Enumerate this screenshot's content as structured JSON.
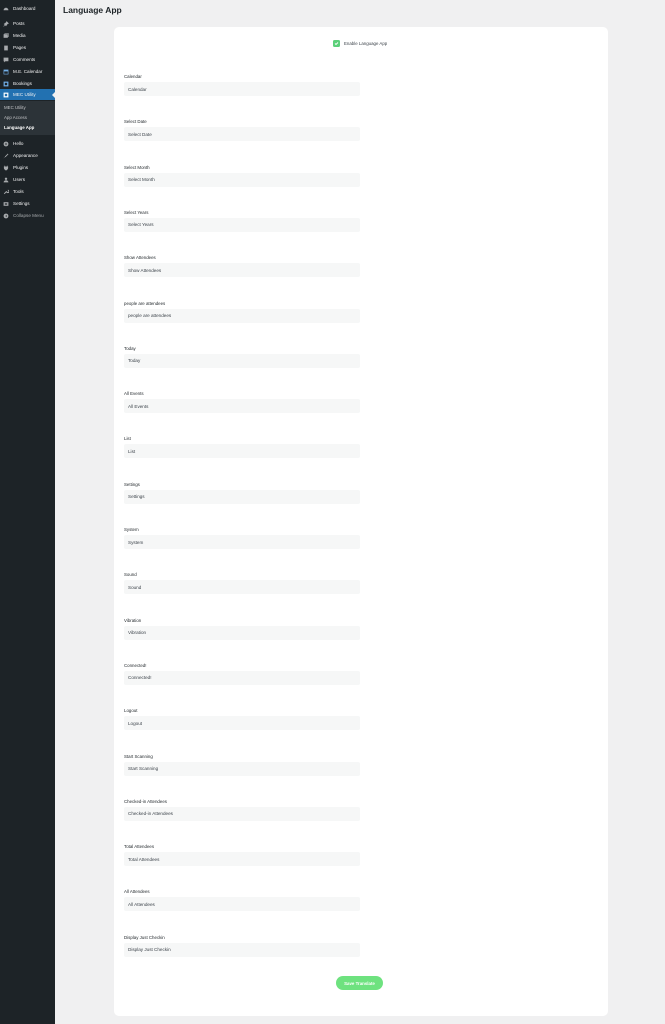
{
  "sidebar": {
    "items": [
      {
        "label": "Dashboard",
        "icon": "dashboard-icon"
      },
      {
        "label": "Posts",
        "icon": "pin-icon"
      },
      {
        "label": "Media",
        "icon": "media-icon"
      },
      {
        "label": "Pages",
        "icon": "pages-icon"
      },
      {
        "label": "Comments",
        "icon": "comment-icon"
      },
      {
        "label": "M.E. Calendar",
        "icon": "calendar-icon"
      },
      {
        "label": "Bookings",
        "icon": "bookings-icon"
      },
      {
        "label": "MEC Utility",
        "icon": "mec-utility-icon"
      },
      {
        "label": "Hello",
        "icon": "plus-circle-icon"
      },
      {
        "label": "Appearance",
        "icon": "brush-icon"
      },
      {
        "label": "Plugins",
        "icon": "plugin-icon"
      },
      {
        "label": "Users",
        "icon": "users-icon"
      },
      {
        "label": "Tools",
        "icon": "wrench-icon"
      },
      {
        "label": "Settings",
        "icon": "settings-icon"
      },
      {
        "label": "Collapse Menu",
        "icon": "collapse-icon"
      }
    ],
    "submenu": [
      "MEC Utility",
      "App Access",
      "Language App"
    ]
  },
  "page": {
    "title": "Language App"
  },
  "enable": {
    "label": "Enable Language App",
    "checked": true
  },
  "fields": [
    {
      "label": "Calendar",
      "value": "Calendar"
    },
    {
      "label": "Select Date",
      "value": "Select Date"
    },
    {
      "label": "Select Month",
      "value": "Select Month"
    },
    {
      "label": "Select Years",
      "value": "Select Years"
    },
    {
      "label": "Show Attendees",
      "value": "Show Attendees"
    },
    {
      "label": "people are attendees",
      "value": "people are attendees"
    },
    {
      "label": "Today",
      "value": "Today"
    },
    {
      "label": "All Events",
      "value": "All Events"
    },
    {
      "label": "List",
      "value": "List"
    },
    {
      "label": "Settings",
      "value": "Settings"
    },
    {
      "label": "System",
      "value": "System"
    },
    {
      "label": "Sound",
      "value": "Sound"
    },
    {
      "label": "Vibration",
      "value": "Vibration"
    },
    {
      "label": "Connected!",
      "value": "Connected!"
    },
    {
      "label": "Logout",
      "value": "Logout"
    },
    {
      "label": "Start Scanning",
      "value": "Start Scanning"
    },
    {
      "label": "Checked-in Attendees",
      "value": "Checked-in Attendees"
    },
    {
      "label": "Total Attendees",
      "value": "Total Attendees"
    },
    {
      "label": "All Attendees",
      "value": "All Attendees"
    },
    {
      "label": "Display Just Checkin",
      "value": "Display Just Checkin"
    }
  ],
  "save_label": "Save Translate",
  "colors": {
    "sidebar_bg": "#1d2327",
    "active_menu": "#2271b1",
    "accent_green": "#6ee27f",
    "page_bg": "#f0f0f1"
  }
}
